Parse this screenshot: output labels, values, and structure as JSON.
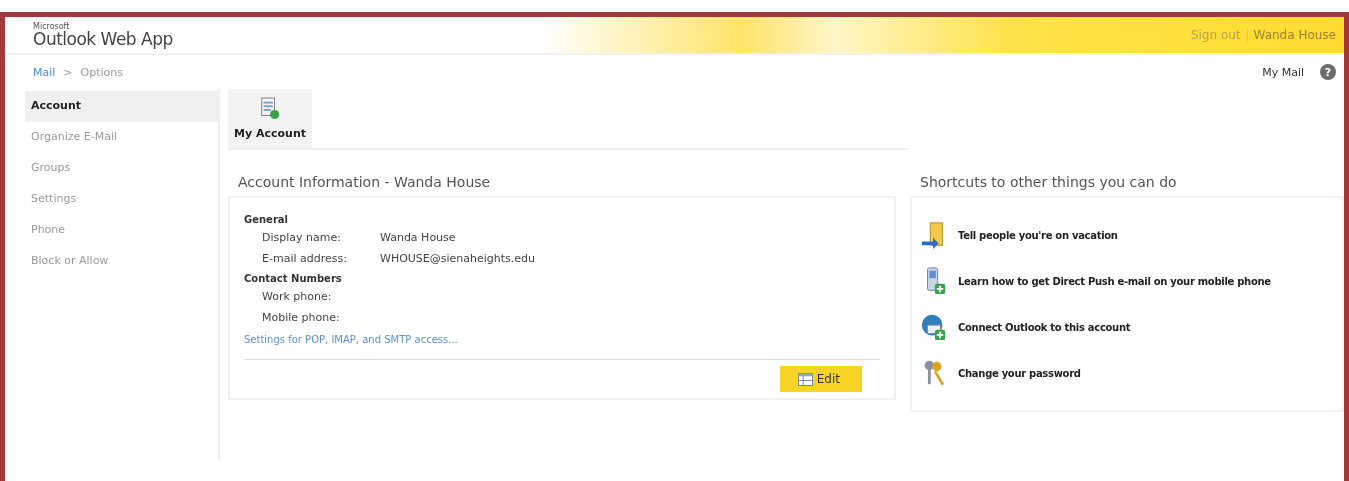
{
  "header": {
    "brand_small": "Microsoft",
    "brand": "Outlook Web App",
    "sign_out": "Sign out",
    "user": "Wanda House"
  },
  "breadcrumb": {
    "items": [
      "Mail",
      "Options"
    ],
    "separator": ">",
    "right_link": "My Mail",
    "help": "?"
  },
  "sidebar": {
    "items": [
      {
        "label": "Account",
        "selected": true
      },
      {
        "label": "Organize E-Mail",
        "selected": false
      },
      {
        "label": "Groups",
        "selected": false
      },
      {
        "label": "Settings",
        "selected": false
      },
      {
        "label": "Phone",
        "selected": false
      },
      {
        "label": "Block or Allow",
        "selected": false
      }
    ]
  },
  "tabs": [
    {
      "label": "My Account",
      "selected": true
    }
  ],
  "account": {
    "title": "Account Information - Wanda House",
    "sections": [
      {
        "heading": "General",
        "fields": [
          {
            "label": "Display name:",
            "value": "Wanda House"
          },
          {
            "label": "E-mail address:",
            "value": "WHOUSE@sienaheights.edu"
          }
        ]
      },
      {
        "heading": "Contact Numbers",
        "fields": [
          {
            "label": "Work phone:"
          },
          {
            "label": "Mobile phone:"
          }
        ]
      }
    ],
    "link": "Settings for POP, IMAP, and SMTP access...",
    "edit_button": "Edit"
  },
  "shortcuts": {
    "title": "Shortcuts to other things you can do",
    "items": [
      {
        "kind": "vacation",
        "label": "Tell people you're on vacation"
      },
      {
        "kind": "phone",
        "label": "Learn how to get Direct Push e-mail on your mobile phone"
      },
      {
        "kind": "connect",
        "label": "Connect Outlook to this account"
      },
      {
        "kind": "keys",
        "label": "Change your password"
      }
    ]
  }
}
